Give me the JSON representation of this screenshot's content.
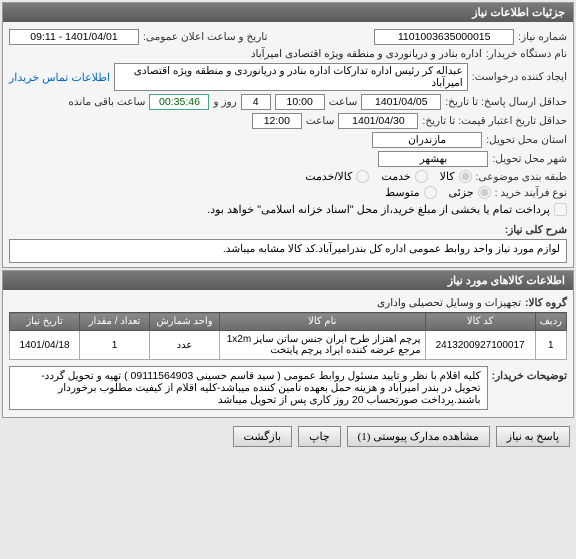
{
  "header": "جزئیات اطلاعات نیاز",
  "fields": {
    "need_no_label": "شماره نیاز:",
    "need_no": "1101003635000015",
    "announce_label": "تاریخ و ساعت اعلان عمومی:",
    "announce_value": "1401/04/01 - 09:11",
    "buyer_label": "نام دستگاه خریدار:",
    "buyer_value": "اداره بنادر و دریانوردی و منطقه ویژه اقتصادی امیرآباد",
    "requester_label": "ایجاد کننده درخواست:",
    "requester_value": "عبداله کر رئیس اداره تدارکات اداره بنادر و دریانوردی و منطقه ویژه اقتصادی امیرآباد",
    "contact_link": "اطلاعات تماس خریدار",
    "deadline_label": "حداقل ارسال پاسخ: تا تاریخ:",
    "deadline_date": "1401/04/05",
    "hour_label": "ساعت",
    "deadline_hour": "10:00",
    "days_label": "روز و",
    "days_value": "4",
    "remain_label": "ساعت باقی مانده",
    "remain_time": "00:35:46",
    "price_valid_label": "حداقل تاریخ اعتبار قیمت: تا تاریخ:",
    "price_valid_date": "1401/04/30",
    "price_valid_hour": "12:00",
    "province_label": "استان محل تحویل:",
    "province_value": "مازندران",
    "city_label": "شهر محل تحویل:",
    "city_value": "بهشهر",
    "category_label": "طبقه بندی موضوعی:",
    "cat_goods": "کالا",
    "cat_service": "خدمت",
    "cat_both": "کالا/خدمت",
    "process_label": "نوع فرآیند خرید :",
    "proc_partial": "جزئی",
    "proc_medium": "متوسط",
    "pay_note": "پرداخت تمام یا بخشی از مبلغ خرید،از محل \"اسناد خزانه اسلامی\" خواهد بود."
  },
  "desc": {
    "title_label": "شرح کلی نیاز:",
    "title_text": "لوازم مورد نیاز واحد روابط عمومی اداره کل بندرامیرآباد.کد کالا مشابه میباشد."
  },
  "items_header": "اطلاعات کالاهای مورد نیاز",
  "group_label": "گروه کالا:",
  "group_value": "تجهیزات و وسایل تحصیلی واداری",
  "table": {
    "headers": [
      "ردیف",
      "کد کالا",
      "نام کالا",
      "واحد شمارش",
      "تعداد / مقدار",
      "تاریخ نیاز"
    ],
    "row": {
      "idx": "1",
      "code": "2413200927100017",
      "name": "پرچم اهتزاز طرح ایران جنس ساتن سایز 1x2m مرجع عرضه کننده ایراد پرچم پایتخت",
      "unit": "عدد",
      "qty": "1",
      "date": "1401/04/18"
    }
  },
  "buyer_notes_label": "توضیحات خریدار:",
  "buyer_notes": "کلیه اقلام با نظر و تایید مسئول روابط عمومی ( سید قاسم حسینی 09111564903 ) تهیه و تحویل گردد- تحویل در بندر امیرآباد و هزینه حمل بعهده تامین کننده میباشد-کلیه اقلام از کیفیت مطلوب برخوردار باشند.پرداخت صورتحساب 20 روز کاری پس از تحویل میباشد",
  "buttons": {
    "reply": "پاسخ به نیاز",
    "attachments": "مشاهده مدارک پیوستی (1)",
    "print": "چاپ",
    "back": "بازگشت"
  }
}
